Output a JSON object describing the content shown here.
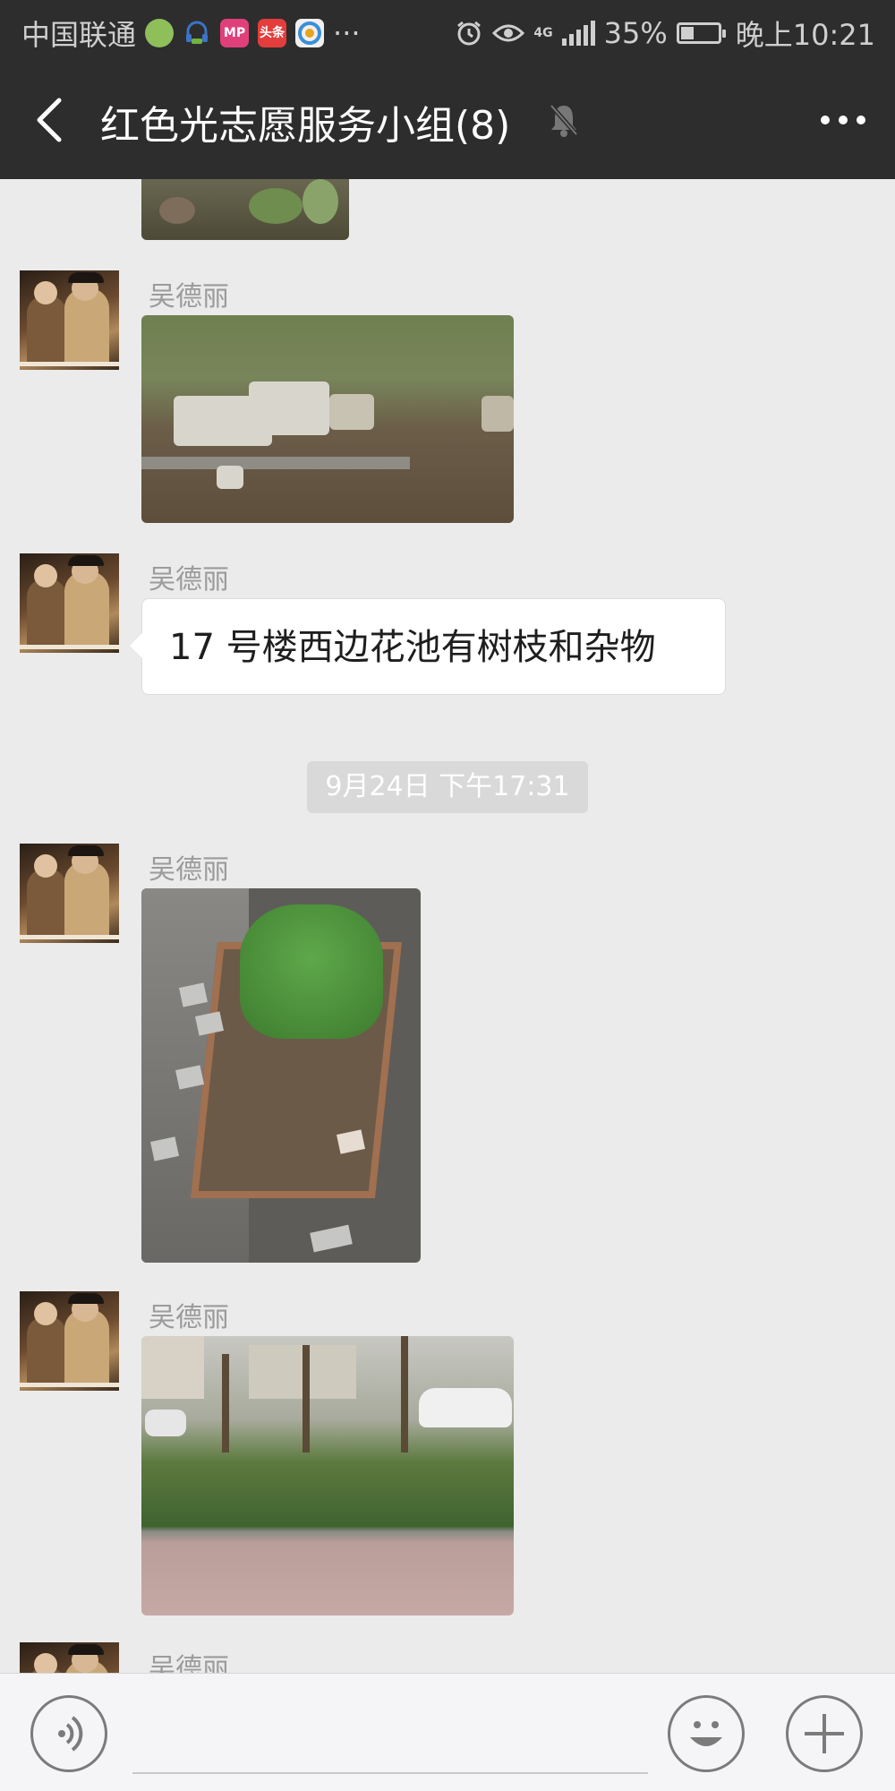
{
  "status_bar": {
    "carrier": "中国联通",
    "app_icons": [
      {
        "name": "hospital-app-icon",
        "text": "",
        "color": "#8fbf5b"
      },
      {
        "name": "headset-app-icon",
        "text": "",
        "color": "#3b74c8"
      },
      {
        "name": "mp-app-icon",
        "text": "MP",
        "color": "#e0407a"
      },
      {
        "name": "toutiao-app-icon",
        "text": "头条",
        "color": "#e43d3d"
      },
      {
        "name": "browser-app-icon",
        "text": "",
        "color": "#f0f0f0"
      }
    ],
    "more": "···",
    "network": "4G",
    "battery": "35%",
    "battery_level": 0.35,
    "time": "晚上10:21"
  },
  "header": {
    "title": "红色光志愿服务小组(8)",
    "muted": true,
    "back_icon": "chevron-left-icon",
    "more_icon": "ellipsis-icon"
  },
  "messages": [
    {
      "type": "image",
      "sender": "",
      "photo": "weeds-ground",
      "partial_top": true
    },
    {
      "type": "image",
      "sender": "吴德丽",
      "photo": "rubble-on-grass"
    },
    {
      "type": "text",
      "sender": "吴德丽",
      "text": "17 号楼西边花池有树枝和杂物"
    },
    {
      "type": "timestamp",
      "text": "9月24日 下午17:31"
    },
    {
      "type": "image",
      "sender": "吴德丽",
      "photo": "flower-bed"
    },
    {
      "type": "image",
      "sender": "吴德丽",
      "photo": "street-shrubs"
    },
    {
      "type": "image",
      "sender": "吴德丽",
      "photo": "",
      "partial_bottom": true
    }
  ],
  "input_bar": {
    "voice_icon": "voice-icon",
    "emoji_icon": "smiley-icon",
    "plus_icon": "plus-icon",
    "placeholder": ""
  }
}
